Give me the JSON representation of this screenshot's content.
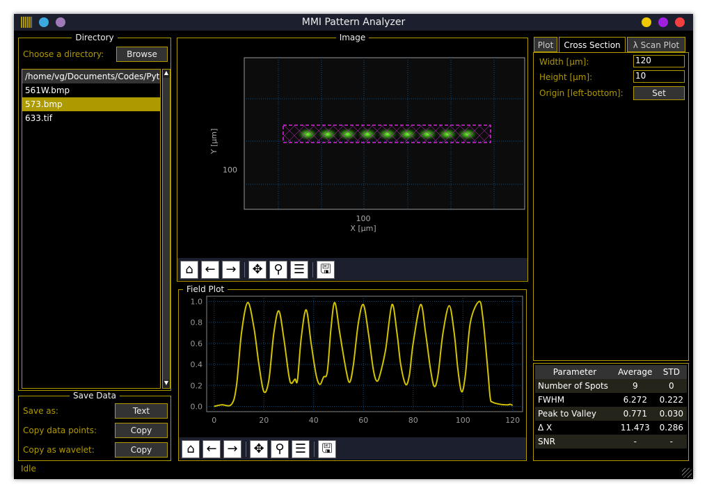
{
  "window": {
    "title": "MMI Pattern Analyzer",
    "status": "Idle"
  },
  "directory": {
    "title": "Directory",
    "choose_label": "Choose a directory:",
    "browse_label": "Browse",
    "path": "/home/vg/Documents/Codes/Python",
    "files": [
      {
        "name": "561W.bmp",
        "selected": false
      },
      {
        "name": "573.bmp",
        "selected": true
      },
      {
        "name": "633.tif",
        "selected": false
      }
    ]
  },
  "save": {
    "title": "Save Data",
    "save_as_label": "Save as:",
    "save_as_button": "Text",
    "copy_points_label": "Copy data points:",
    "copy_points_button": "Copy",
    "copy_wavelet_label": "Copy as wavelet:",
    "copy_wavelet_button": "Copy"
  },
  "image": {
    "title": "Image",
    "xlabel": "X [µm]",
    "ylabel": "Y [µm]",
    "xtick": "100",
    "ytick": "100",
    "spots": 9
  },
  "toolbar": {
    "icons": [
      "home-icon",
      "back-arrow-icon",
      "forward-arrow-icon",
      "pan-icon",
      "zoom-icon",
      "configure-subplots-icon",
      "save-icon"
    ]
  },
  "field_plot": {
    "title": "Field Plot"
  },
  "chart_data": {
    "type": "line",
    "color": "#d4c400",
    "grid": true,
    "xlim": [
      -3,
      124
    ],
    "ylim": [
      -0.05,
      1.05
    ],
    "xticks": [
      0,
      20,
      40,
      60,
      80,
      100,
      120
    ],
    "yticks": [
      "0.0",
      "0.2",
      "0.4",
      "0.6",
      "0.8",
      "1.0"
    ],
    "x": [
      0,
      3,
      7,
      9,
      11,
      13.5,
      16,
      18,
      20,
      22,
      24,
      26,
      28,
      30,
      31,
      32.5,
      33.5,
      35,
      37,
      39,
      41,
      42.5,
      44,
      45.5,
      47,
      48.5,
      50.5,
      53,
      54.5,
      56,
      58,
      60,
      62,
      64,
      65.5,
      67,
      69,
      71.5,
      73.5,
      75,
      77,
      78.5,
      80,
      83,
      85,
      87,
      88.5,
      90,
      92,
      94.5,
      96.5,
      98,
      99.5,
      101,
      103,
      106.5,
      108,
      110,
      111,
      112,
      115,
      118,
      119,
      120
    ],
    "y": [
      0,
      0.015,
      0.02,
      0.2,
      0.7,
      0.99,
      0.75,
      0.4,
      0.14,
      0.25,
      0.7,
      0.91,
      0.65,
      0.3,
      0.22,
      0.26,
      0.25,
      0.65,
      0.92,
      0.6,
      0.3,
      0.21,
      0.28,
      0.33,
      0.75,
      0.99,
      0.7,
      0.35,
      0.23,
      0.4,
      0.8,
      0.97,
      0.7,
      0.35,
      0.24,
      0.33,
      0.55,
      0.97,
      0.7,
      0.4,
      0.21,
      0.3,
      0.6,
      0.97,
      0.7,
      0.35,
      0.19,
      0.3,
      0.7,
      0.96,
      0.7,
      0.35,
      0.14,
      0.3,
      0.8,
      1.0,
      0.85,
      0.35,
      0.08,
      0.04,
      0.02,
      0.015,
      0.02,
      0.01
    ]
  },
  "tabs": [
    {
      "label": "Plot",
      "active": false
    },
    {
      "label": "Cross Section",
      "active": true
    },
    {
      "label": "λ Scan Plot",
      "active": false
    }
  ],
  "cross_section": {
    "width_label": "Width [µm]:",
    "width_value": "120",
    "height_label": "Height [µm]:",
    "height_value": "10",
    "origin_label": "Origin [left-bottom]:",
    "set_button": "Set"
  },
  "results": {
    "headers": [
      "Parameter",
      "Average",
      "STD"
    ],
    "rows": [
      [
        "Number of Spots",
        "9",
        "0"
      ],
      [
        "FWHM",
        "6.272",
        "0.222"
      ],
      [
        "Peak to Valley",
        "0.771",
        "0.030"
      ],
      [
        "Δ X",
        "11.473",
        "0.286"
      ],
      [
        "SNR",
        "-",
        "-"
      ]
    ]
  }
}
